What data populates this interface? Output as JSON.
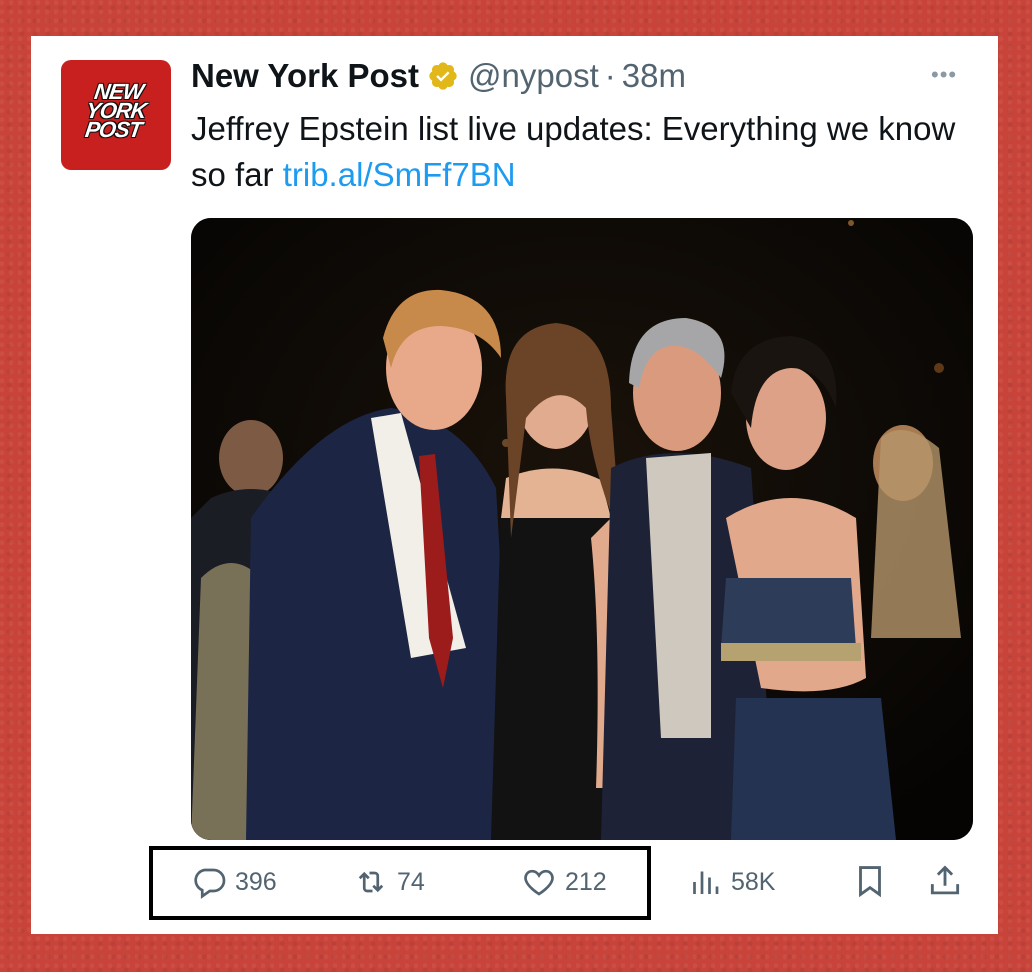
{
  "tweet": {
    "avatar_logo": [
      "NEW",
      "YORK",
      "POST"
    ],
    "display_name": "New York Post",
    "verified_icon": "gold-verified-badge-icon",
    "handle": "@nypost",
    "separator": "·",
    "time": "38m",
    "more_label": "•••",
    "text": "Jeffrey Epstein list live updates: Everything we know so far ",
    "link": "trib.al/SmFf7BN",
    "media": {
      "type": "photo",
      "subject": "four people posing at a nighttime event"
    }
  },
  "actions": {
    "replies": {
      "icon": "reply-icon",
      "count": "396"
    },
    "reposts": {
      "icon": "repost-icon",
      "count": "74"
    },
    "likes": {
      "icon": "heart-icon",
      "count": "212"
    },
    "views": {
      "icon": "views-chart-icon",
      "count": "58K"
    },
    "bookmark": {
      "icon": "bookmark-icon"
    },
    "share": {
      "icon": "share-icon"
    }
  },
  "colors": {
    "frame_background": "#c8443a",
    "card": "#ffffff",
    "avatar_red": "#c8201e",
    "link_blue": "#1d9bf0",
    "verified_gold": "#e2b719",
    "muted_text": "#536471",
    "highlight_box": "#000000"
  }
}
